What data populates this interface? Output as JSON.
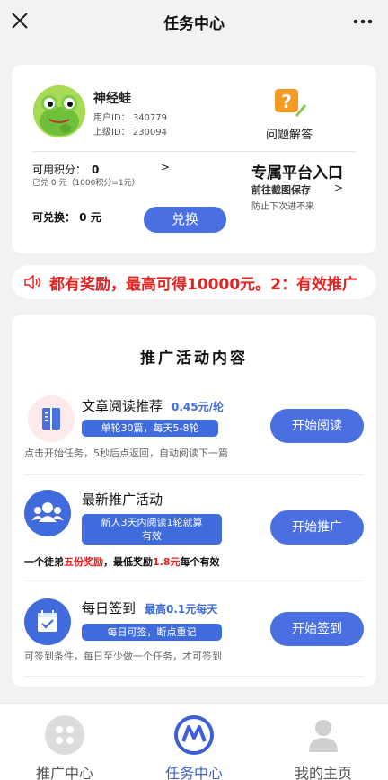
{
  "header": {
    "title": "任务中心",
    "close_icon": "close-icon",
    "more_icon": "more-dots-icon"
  },
  "profile": {
    "name": "神经蛙",
    "user_id": "用户ID： 340779",
    "parent_id": "上级ID： 230094",
    "faq_label": "问题解答"
  },
  "points": {
    "label": "可用积分：",
    "value": "0",
    "arrow": ">",
    "redeemed": "已兑 0 元（1000积分=1元）",
    "exchangeable": "可兑换： 0 元",
    "exchange_button": "兑换"
  },
  "platform": {
    "title": "专属平台入口",
    "subtitle": "前往截图保存",
    "arrow": ">",
    "note": "防止下次进不来"
  },
  "notice": {
    "text": "都有奖励，最高可得10000元。2：有效推广"
  },
  "activities": {
    "title": "推广活动内容",
    "items": [
      {
        "title": "文章阅读推荐",
        "sub": "0.45元/轮",
        "pill": "单轮30篇，每天5-8轮",
        "button": "开始阅读",
        "note": "点击开始任务，5秒后点返回，自动阅读下一篇"
      },
      {
        "title": "最新推广活动",
        "sub": "",
        "pill_line1": "新人3天内阅读1轮就算",
        "pill_line2": "有效",
        "button": "开始推广",
        "note_a": "一个徒弟",
        "note_b": "五份奖励",
        "note_c": "，最低奖励",
        "note_d": "1.8元",
        "note_e": "每个有效"
      },
      {
        "title": "每日签到",
        "sub": "最高0.1元每天",
        "pill": "每日可签，断点重记",
        "button": "开始签到",
        "note": "可签到条件，每日至少做一个任务，才可签到"
      }
    ]
  },
  "tabbar": {
    "tabs": [
      {
        "label": "推广中心"
      },
      {
        "label": "任务中心"
      },
      {
        "label": "我的主页"
      }
    ]
  },
  "colors": {
    "accent": "#4a6fe0",
    "alert": "#e52222"
  }
}
